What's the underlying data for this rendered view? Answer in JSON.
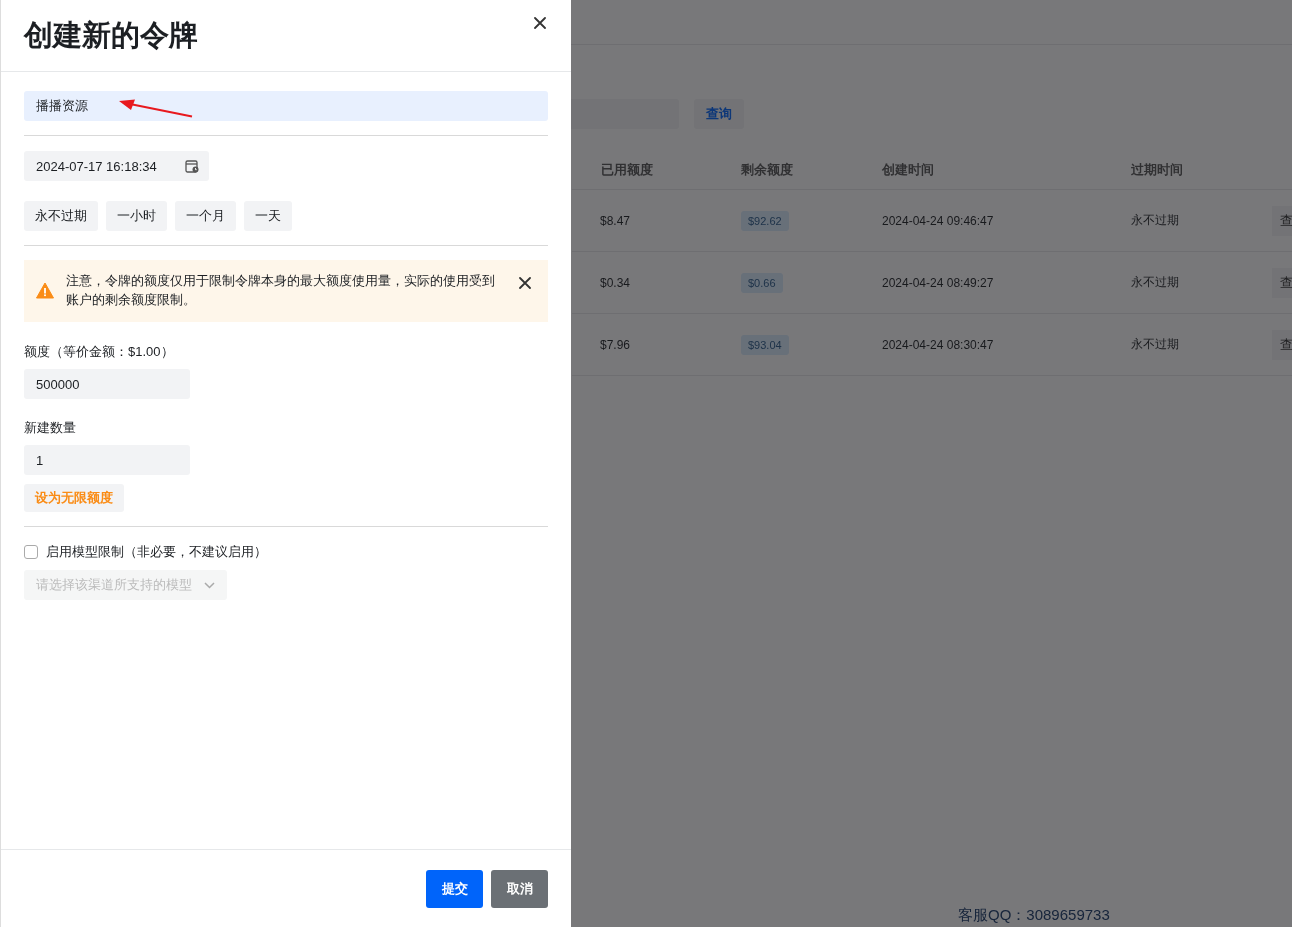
{
  "background": {
    "search_button": "查询",
    "table": {
      "columns": [
        "已用额度",
        "剩余额度",
        "创建时间",
        "过期时间"
      ],
      "rows": [
        {
          "used": "$8.47",
          "remaining": "$92.62",
          "created": "2024-04-24 09:46:47",
          "expires": "永不过期",
          "action": "查"
        },
        {
          "used": "$0.34",
          "remaining": "$0.66",
          "created": "2024-04-24 08:49:27",
          "expires": "永不过期",
          "action": "查"
        },
        {
          "used": "$7.96",
          "remaining": "$93.04",
          "created": "2024-04-24 08:30:47",
          "expires": "永不过期",
          "action": "查"
        }
      ]
    },
    "footer": "客服QQ：3089659733"
  },
  "drawer": {
    "title": "创建新的令牌",
    "name_field": {
      "value": "播播资源"
    },
    "expiry_field": {
      "value": "2024-07-17 16:18:34"
    },
    "quick_times": [
      "永不过期",
      "一小时",
      "一个月",
      "一天"
    ],
    "alert": {
      "text": "注意，令牌的额度仅用于限制令牌本身的最大额度使用量，实际的使用受到账户的剩余额度限制。"
    },
    "quota": {
      "label": "额度（等价金额：$1.00）",
      "value": "500000"
    },
    "count": {
      "label": "新建数量",
      "value": "1"
    },
    "unlimited_button": "设为无限额度",
    "model_limit": {
      "label": "启用模型限制（非必要，不建议启用）",
      "checked": false
    },
    "model_select": {
      "placeholder": "请选择该渠道所支持的模型",
      "disabled": true
    },
    "buttons": [
      {
        "label": "提交",
        "kind": "primary"
      },
      {
        "label": "取消",
        "kind": "secondary"
      }
    ]
  }
}
